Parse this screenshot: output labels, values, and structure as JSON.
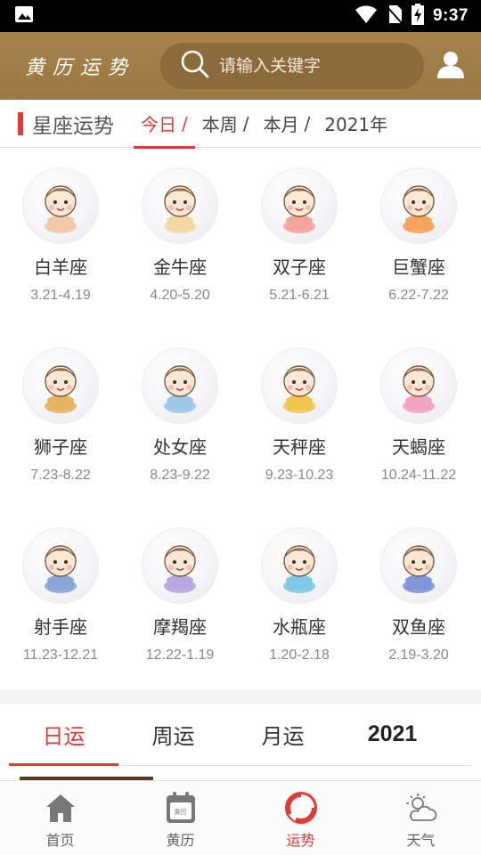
{
  "status_bar": {
    "time": "9:37"
  },
  "header": {
    "app_title": "黄历运势",
    "search_placeholder": "请输入关键字"
  },
  "section": {
    "title": "星座运势",
    "tabs": [
      {
        "label": "今日",
        "separator": "/"
      },
      {
        "label": "本周",
        "separator": "/"
      },
      {
        "label": "本月",
        "separator": "/"
      },
      {
        "label": "2021年",
        "separator": ""
      }
    ],
    "active_tab": 0
  },
  "zodiacs": [
    {
      "name": "白羊座",
      "dates": "3.21-4.19",
      "icon": "aries-icon",
      "color": "#f0c9a8"
    },
    {
      "name": "金牛座",
      "dates": "4.20-5.20",
      "icon": "taurus-icon",
      "color": "#f2d9a2"
    },
    {
      "name": "双子座",
      "dates": "5.21-6.21",
      "icon": "gemini-icon",
      "color": "#f4a3a0"
    },
    {
      "name": "巨蟹座",
      "dates": "6.22-7.22",
      "icon": "cancer-icon",
      "color": "#f4a35c"
    },
    {
      "name": "狮子座",
      "dates": "7.23-8.22",
      "icon": "leo-icon",
      "color": "#e6b35f"
    },
    {
      "name": "处女座",
      "dates": "8.23-9.22",
      "icon": "virgo-icon",
      "color": "#9fc6e8"
    },
    {
      "name": "天秤座",
      "dates": "9.23-10.23",
      "icon": "libra-icon",
      "color": "#f1c64a"
    },
    {
      "name": "天蝎座",
      "dates": "10.24-11.22",
      "icon": "scorpio-icon",
      "color": "#f3a3c0"
    },
    {
      "name": "射手座",
      "dates": "11.23-12.21",
      "icon": "sagittarius-icon",
      "color": "#8aa6d8"
    },
    {
      "name": "摩羯座",
      "dates": "12.22-1.19",
      "icon": "capricorn-icon",
      "color": "#b7a6e0"
    },
    {
      "name": "水瓶座",
      "dates": "1.20-2.18",
      "icon": "aquarius-icon",
      "color": "#7fc8e6"
    },
    {
      "name": "双鱼座",
      "dates": "2.19-3.20",
      "icon": "pisces-icon",
      "color": "#7f96d8"
    }
  ],
  "fortune_tabs": [
    {
      "label": "日运"
    },
    {
      "label": "周运"
    },
    {
      "label": "月运"
    },
    {
      "label": "2021"
    }
  ],
  "fortune_active": 0,
  "bottom_nav": [
    {
      "label": "首页",
      "icon": "home-icon"
    },
    {
      "label": "黄历",
      "icon": "calendar-icon",
      "icon_text": "黄历"
    },
    {
      "label": "运势",
      "icon": "fortune-icon"
    },
    {
      "label": "天气",
      "icon": "weather-icon"
    }
  ],
  "bottom_nav_active": 2,
  "colors": {
    "brand": "#a07d46",
    "accent": "#e53935",
    "search_bg": "#8b6b3b"
  }
}
